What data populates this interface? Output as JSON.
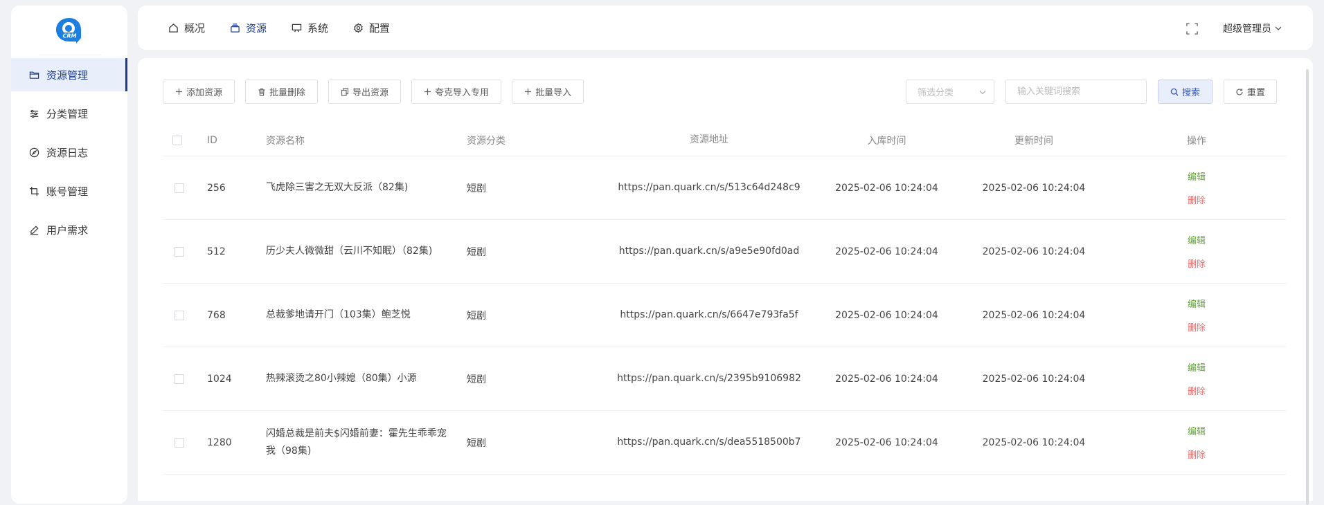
{
  "brand": {
    "logo_text": "CRM",
    "logo_color": "#1c7fe0"
  },
  "colors": {
    "primary": "#1b3a8c",
    "edit": "#5ea335",
    "delete": "#ec6d6d"
  },
  "sidebar": {
    "items": [
      {
        "label": "资源管理",
        "icon": "folder-icon",
        "active": true
      },
      {
        "label": "分类管理",
        "icon": "sliders-icon"
      },
      {
        "label": "资源日志",
        "icon": "compass-icon"
      },
      {
        "label": "账号管理",
        "icon": "crop-icon"
      },
      {
        "label": "用户需求",
        "icon": "pen-icon"
      }
    ]
  },
  "topnav": {
    "items": [
      {
        "label": "概况",
        "icon": "home-icon"
      },
      {
        "label": "资源",
        "icon": "layers-icon",
        "active": true
      },
      {
        "label": "系统",
        "icon": "monitor-icon"
      },
      {
        "label": "配置",
        "icon": "gear-icon"
      }
    ],
    "user": "超级管理员"
  },
  "toolbar": {
    "add": "添加资源",
    "batch_delete": "批量删除",
    "export": "导出资源",
    "quark_import": "夸克导入专用",
    "batch_import": "批量导入"
  },
  "filter": {
    "category_placeholder": "筛选分类",
    "keyword_placeholder": "输入关键词搜索",
    "search": "搜索",
    "reset": "重置"
  },
  "table": {
    "headers": {
      "id": "ID",
      "name": "资源名称",
      "category": "资源分类",
      "url": "资源地址",
      "created": "入库时间",
      "updated": "更新时间",
      "actions": "操作"
    },
    "edit_label": "编辑",
    "delete_label": "删除",
    "rows": [
      {
        "id": "256",
        "name": "飞虎除三害之无双大反派（82集)",
        "category": "短剧",
        "url": "https://pan.quark.cn/s/513c64d248c9",
        "created": "2025-02-06 10:24:04",
        "updated": "2025-02-06 10:24:04"
      },
      {
        "id": "512",
        "name": "历少夫人微微甜（云川不知眠）（82集)",
        "category": "短剧",
        "url": "https://pan.quark.cn/s/a9e5e90fd0ad",
        "created": "2025-02-06 10:24:04",
        "updated": "2025-02-06 10:24:04"
      },
      {
        "id": "768",
        "name": "总裁爹地请开门（103集）鲍芝悦",
        "category": "短剧",
        "url": "https://pan.quark.cn/s/6647e793fa5f",
        "created": "2025-02-06 10:24:04",
        "updated": "2025-02-06 10:24:04"
      },
      {
        "id": "1024",
        "name": "热辣滚烫之80小辣媳（80集）小源",
        "category": "短剧",
        "url": "https://pan.quark.cn/s/2395b9106982",
        "created": "2025-02-06 10:24:04",
        "updated": "2025-02-06 10:24:04"
      },
      {
        "id": "1280",
        "name": "闪婚总裁是前夫$闪婚前妻：霍先生乖乖宠我（98集)",
        "category": "短剧",
        "url": "https://pan.quark.cn/s/dea5518500b7",
        "created": "2025-02-06 10:24:04",
        "updated": "2025-02-06 10:24:04"
      }
    ]
  }
}
